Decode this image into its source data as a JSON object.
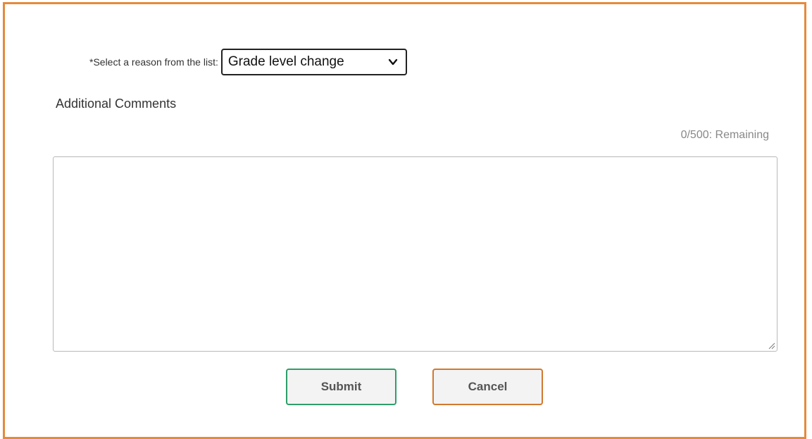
{
  "form": {
    "reason_label": "*Select a reason from the list:",
    "reason_selected": "Grade level change",
    "comments_heading": "Additional Comments",
    "char_counter": "0/500: Remaining",
    "comments_value": "",
    "submit_label": "Submit",
    "cancel_label": "Cancel"
  },
  "icons": {
    "select_arrow": "chevron-down-icon",
    "textarea_resize": "resize-grip-icon"
  },
  "colors": {
    "frame_border": "#e58a3b",
    "submit_border": "#2e9e6a",
    "cancel_border": "#d2782f"
  }
}
